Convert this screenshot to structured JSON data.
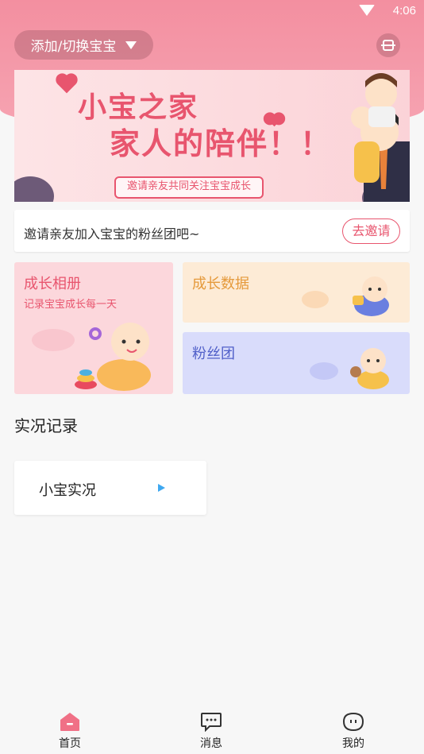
{
  "status": {
    "time": "4:06"
  },
  "header": {
    "switch_label": "添加/切换宝宝"
  },
  "banner": {
    "title_line1": "小宝之家",
    "title_line2": "家人的陪伴！！",
    "ribbon": "邀请亲友共同关注宝宝成长"
  },
  "invite": {
    "text": "邀请亲友加入宝宝的粉丝团吧~",
    "button": "去邀请"
  },
  "cards": {
    "album": {
      "title": "成长相册",
      "subtitle": "记录宝宝成长每一天"
    },
    "growth": {
      "title": "成长数据"
    },
    "fans": {
      "title": "粉丝团"
    }
  },
  "live": {
    "section_title": "实况记录",
    "item": "小宝实况"
  },
  "tabs": [
    {
      "label": "首页",
      "icon": "home-icon",
      "active": true
    },
    {
      "label": "消息",
      "icon": "message-icon",
      "active": false
    },
    {
      "label": "我的",
      "icon": "profile-icon",
      "active": false
    }
  ],
  "colors": {
    "accent": "#e8556e",
    "header": "#f38fa0",
    "album_bg": "#fcd7dc",
    "growth_bg": "#fdebd6",
    "fans_bg": "#d9dcfb"
  }
}
